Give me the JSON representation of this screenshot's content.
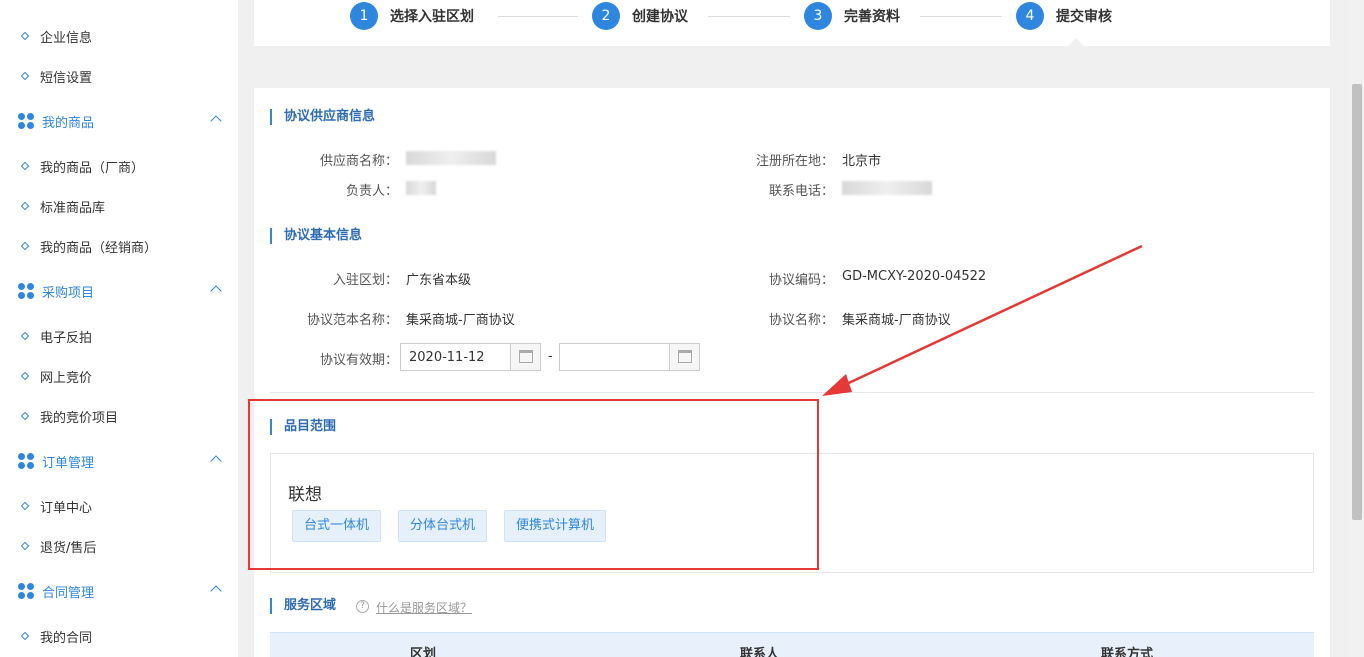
{
  "sidebar": {
    "items": [
      {
        "type": "sub",
        "label": "企业信息"
      },
      {
        "type": "sub",
        "label": "短信设置"
      },
      {
        "type": "group",
        "label": "我的商品"
      },
      {
        "type": "sub",
        "label": "我的商品（厂商）"
      },
      {
        "type": "sub",
        "label": "标准商品库"
      },
      {
        "type": "sub",
        "label": "我的商品（经销商）"
      },
      {
        "type": "group",
        "label": "采购项目"
      },
      {
        "type": "sub",
        "label": "电子反拍"
      },
      {
        "type": "sub",
        "label": "网上竞价"
      },
      {
        "type": "sub",
        "label": "我的竞价项目"
      },
      {
        "type": "group",
        "label": "订单管理"
      },
      {
        "type": "sub",
        "label": "订单中心"
      },
      {
        "type": "sub",
        "label": "退货/售后"
      },
      {
        "type": "group",
        "label": "合同管理"
      },
      {
        "type": "sub",
        "label": "我的合同"
      }
    ]
  },
  "steps": [
    {
      "num": "1",
      "label": "选择入驻区划"
    },
    {
      "num": "2",
      "label": "创建协议"
    },
    {
      "num": "3",
      "label": "完善资料"
    },
    {
      "num": "4",
      "label": "提交审核"
    }
  ],
  "supplier": {
    "title": "协议供应商信息",
    "name_label": "供应商名称：",
    "region_label": "注册所在地：",
    "region_value": "北京市",
    "owner_label": "负责人：",
    "phone_label": "联系电话："
  },
  "basic": {
    "title": "协议基本信息",
    "zone_label": "入驻区划：",
    "zone_value": "广东省本级",
    "code_label": "协议编码：",
    "code_value": "GD-MCXY-2020-04522",
    "template_label": "协议范本名称：",
    "template_value": "集采商城-厂商协议",
    "agreement_label": "协议名称：",
    "agreement_value": "集采商城-厂商协议",
    "validity_label": "协议有效期：",
    "start_date": "2020-11-12",
    "end_date": "",
    "dash": "-"
  },
  "category": {
    "title": "品目范围",
    "brand": "联想",
    "tags": [
      "台式一体机",
      "分体台式机",
      "便携式计算机"
    ]
  },
  "service": {
    "title": "服务区域",
    "help": "什么是服务区域？",
    "help_icon": "?",
    "columns": [
      "区划",
      "联系人",
      "联系方式"
    ]
  },
  "colors": {
    "accent": "#2e86de",
    "highlight": "#e53935"
  }
}
